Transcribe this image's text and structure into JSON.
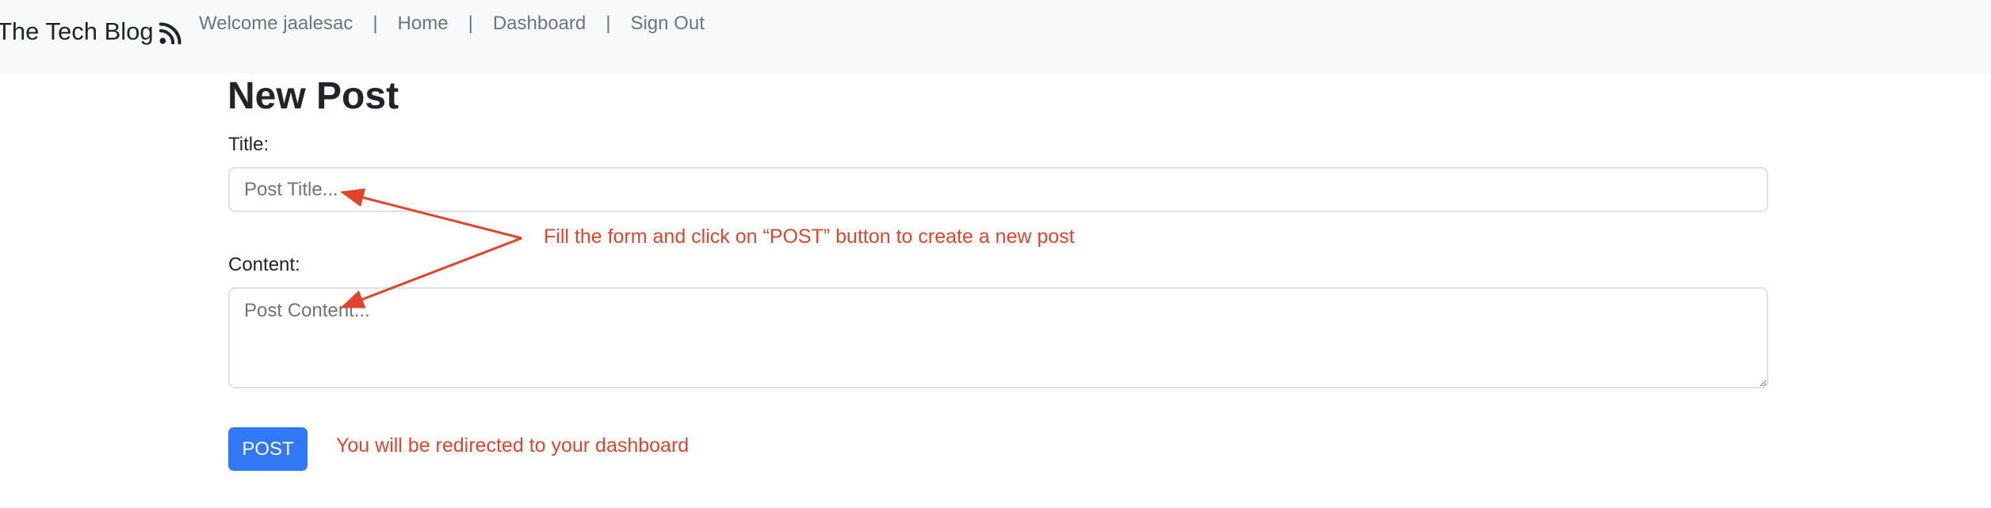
{
  "navbar": {
    "brand": "The Tech Blog",
    "brand_icon": "rss-icon",
    "welcome": "Welcome jaalesac",
    "separator": "|",
    "links": [
      "Home",
      "Dashboard",
      "Sign Out"
    ]
  },
  "page": {
    "title": "New Post"
  },
  "form": {
    "title_label": "Title:",
    "title_placeholder": "Post Title...",
    "title_value": "",
    "content_label": "Content:",
    "content_placeholder": "Post Content...",
    "content_value": "",
    "submit_label": "POST"
  },
  "annotations": {
    "form_hint": "Fill the form and click on “POST” button to create a new post",
    "redirect_hint": "You will be redirected to your dashboard",
    "color": "#e2442b"
  },
  "colors": {
    "primary": "#3178f6",
    "navbar_bg": "#f8f9fa",
    "muted_text": "#6c757d"
  }
}
